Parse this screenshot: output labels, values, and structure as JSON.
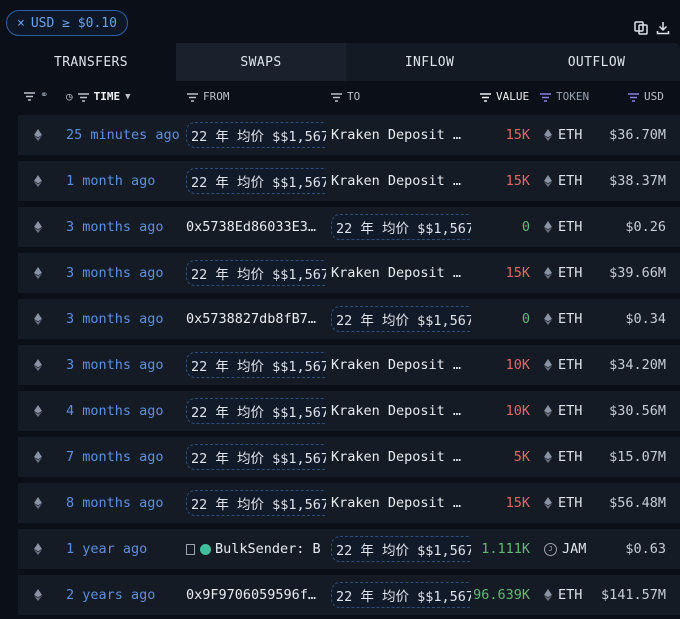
{
  "filter": {
    "label": "USD ≥ $0.10"
  },
  "tabs": [
    {
      "label": "TRANSFERS"
    },
    {
      "label": "SWAPS"
    },
    {
      "label": "INFLOW"
    },
    {
      "label": "OUTFLOW"
    }
  ],
  "headers": {
    "time": "TIME",
    "from": "FROM",
    "to": "TO",
    "value": "VALUE",
    "token": "TOKEN",
    "usd": "USD"
  },
  "rows": [
    {
      "time": "25 minutes ago",
      "from": "22 年 均价 $$1,567",
      "from_pill": true,
      "to": "Kraken Deposit …",
      "to_pill": false,
      "value": "15K",
      "value_color": "red",
      "token": "ETH",
      "usd": "$36.70M"
    },
    {
      "time": "1 month ago",
      "from": "22 年 均价 $$1,567",
      "from_pill": true,
      "to": "Kraken Deposit …",
      "to_pill": false,
      "value": "15K",
      "value_color": "red",
      "token": "ETH",
      "usd": "$38.37M"
    },
    {
      "time": "3 months ago",
      "from": "0x5738Ed86033E3…",
      "from_pill": false,
      "to": "22 年 均价 $$1,567",
      "to_pill": true,
      "value": "0",
      "value_color": "green",
      "token": "ETH",
      "usd": "$0.26"
    },
    {
      "time": "3 months ago",
      "from": "22 年 均价 $$1,567",
      "from_pill": true,
      "to": "Kraken Deposit …",
      "to_pill": false,
      "value": "15K",
      "value_color": "red",
      "token": "ETH",
      "usd": "$39.66M"
    },
    {
      "time": "3 months ago",
      "from": "0x5738827db8fB7…",
      "from_pill": false,
      "to": "22 年 均价 $$1,567",
      "to_pill": true,
      "value": "0",
      "value_color": "green",
      "token": "ETH",
      "usd": "$0.34"
    },
    {
      "time": "3 months ago",
      "from": "22 年 均价 $$1,567",
      "from_pill": true,
      "to": "Kraken Deposit …",
      "to_pill": false,
      "value": "10K",
      "value_color": "red",
      "token": "ETH",
      "usd": "$34.20M"
    },
    {
      "time": "4 months ago",
      "from": "22 年 均价 $$1,567",
      "from_pill": true,
      "to": "Kraken Deposit …",
      "to_pill": false,
      "value": "10K",
      "value_color": "red",
      "token": "ETH",
      "usd": "$30.56M"
    },
    {
      "time": "7 months ago",
      "from": "22 年 均价 $$1,567",
      "from_pill": true,
      "to": "Kraken Deposit …",
      "to_pill": false,
      "value": "5K",
      "value_color": "red",
      "token": "ETH",
      "usd": "$15.07M"
    },
    {
      "time": "8 months ago",
      "from": "22 年 均价 $$1,567",
      "from_pill": true,
      "to": "Kraken Deposit …",
      "to_pill": false,
      "value": "15K",
      "value_color": "red",
      "token": "ETH",
      "usd": "$56.48M"
    },
    {
      "time": "1 year ago",
      "from": "BulkSender: B",
      "from_pill": false,
      "from_entity": true,
      "to": "22 年 均价 $$1,567",
      "to_pill": true,
      "value": "1.111K",
      "value_color": "green",
      "token": "JAM",
      "usd": "$0.63"
    },
    {
      "time": "2 years ago",
      "from": "0x9F9706059596f…",
      "from_pill": false,
      "to": "22 年 均价 $$1,567",
      "to_pill": true,
      "value": "96.639K",
      "value_color": "green",
      "token": "ETH",
      "usd": "$141.57M"
    }
  ]
}
